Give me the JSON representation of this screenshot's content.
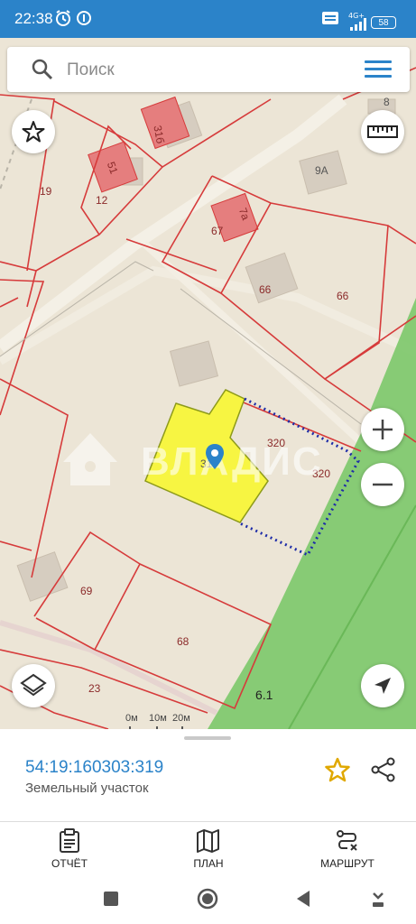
{
  "status_bar": {
    "time": "22:38",
    "network": "4G+",
    "battery": "58"
  },
  "search": {
    "placeholder": "Поиск"
  },
  "map": {
    "parcel_labels": [
      "19",
      "12",
      "51",
      "31б",
      "8",
      "9А",
      "67",
      "7а",
      "66",
      "66",
      "320",
      "320",
      "31",
      "69",
      "68",
      "23",
      "6.1"
    ],
    "watermark": "ВЛАДИС",
    "scale_labels": [
      "0м",
      "10м",
      "20м"
    ]
  },
  "parcel": {
    "cadastral_number": "54:19:160303:319",
    "type": "Земельный участок"
  },
  "actions": {
    "report": "ОТЧЁТ",
    "plan": "ПЛАН",
    "route": "МАРШРУТ"
  },
  "colors": {
    "accent": "#2b83c9",
    "parcel_fill": "#f7f542",
    "boundary": "#d63b3b",
    "green_zone": "#7cc86a",
    "map_bg": "#ece5d6"
  }
}
